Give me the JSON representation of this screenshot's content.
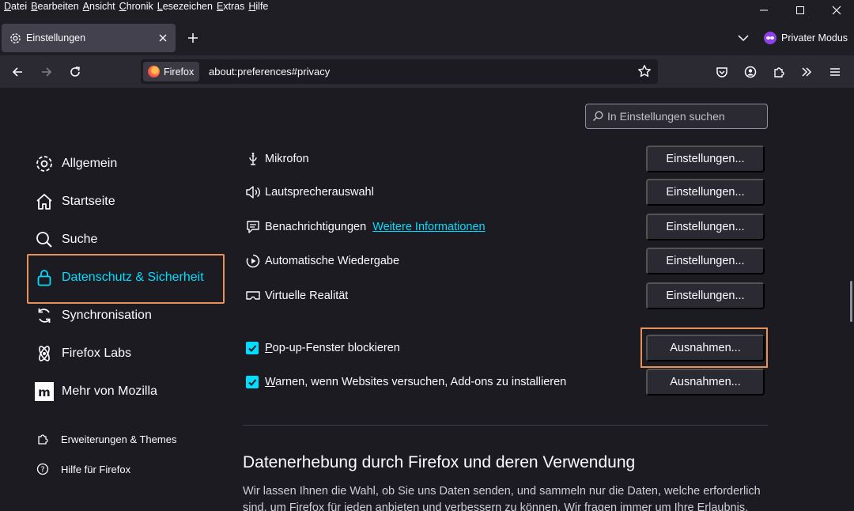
{
  "menu": [
    "Datei",
    "Bearbeiten",
    "Ansicht",
    "Chronik",
    "Lesezeichen",
    "Extras",
    "Hilfe"
  ],
  "tab": {
    "title": "Einstellungen"
  },
  "private_mode": "Privater Modus",
  "urlbar": {
    "identity": "Firefox",
    "url": "about:preferences#privacy"
  },
  "search": {
    "placeholder": "In Einstellungen suchen"
  },
  "categories": [
    {
      "label": "Allgemein",
      "icon": "gear-icon"
    },
    {
      "label": "Startseite",
      "icon": "home-icon"
    },
    {
      "label": "Suche",
      "icon": "search-icon"
    },
    {
      "label": "Datenschutz & Sicherheit",
      "icon": "lock-icon",
      "selected": true
    },
    {
      "label": "Synchronisation",
      "icon": "sync-icon"
    },
    {
      "label": "Firefox Labs",
      "icon": "labs-icon"
    },
    {
      "label": "Mehr von Mozilla",
      "icon": "mozilla-icon"
    }
  ],
  "footer_links": [
    {
      "label": "Erweiterungen & Themes",
      "icon": "puzzle-icon"
    },
    {
      "label": "Hilfe für Firefox",
      "icon": "help-icon"
    }
  ],
  "permissions": [
    {
      "label": "Mikrofon",
      "icon": "microphone-icon",
      "button": "Einstellungen..."
    },
    {
      "label": "Lautsprecherauswahl",
      "icon": "speaker-icon",
      "button": "Einstellungen..."
    },
    {
      "label": "Benachrichtigungen",
      "icon": "notification-icon",
      "link": "Weitere Informationen",
      "button": "Einstellungen..."
    },
    {
      "label": "Automatische Wiedergabe",
      "icon": "autoplay-icon",
      "button": "Einstellungen..."
    },
    {
      "label": "Virtuelle Realität",
      "icon": "vr-icon",
      "button": "Einstellungen..."
    }
  ],
  "checkboxes": [
    {
      "label": "Pop-up-Fenster blockieren",
      "checked": true,
      "button": "Ausnahmen..."
    },
    {
      "label": "Warnen, wenn Websites versuchen, Add-ons zu installieren",
      "checked": true,
      "button": "Ausnahmen..."
    }
  ],
  "data_collection": {
    "heading": "Datenerhebung durch Firefox und deren Verwendung",
    "text": "Wir lassen Ihnen die Wahl, ob Sie uns Daten senden, und sammeln nur die Daten, welche erforderlich sind, um Firefox für jeden anbieten und verbessern zu können. Wir fragen immer um Ihre Erlaubnis,"
  },
  "colors": {
    "accent": "#00ddff",
    "highlight": "#e8925a",
    "background": "#1c1b22"
  }
}
